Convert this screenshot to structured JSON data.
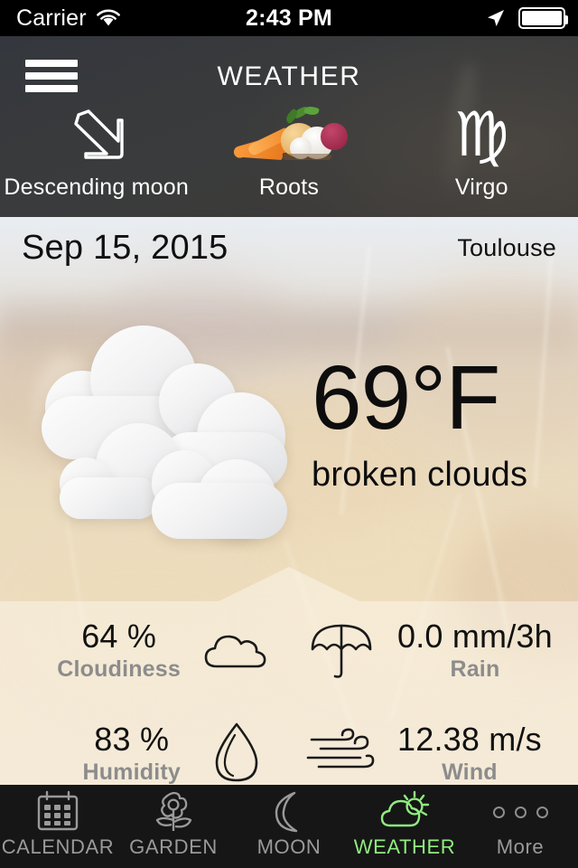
{
  "status_bar": {
    "carrier": "Carrier",
    "time": "2:43 PM",
    "wifi_icon": "wifi-icon",
    "location_icon": "location-arrow-icon",
    "battery_icon": "battery-full-icon"
  },
  "header": {
    "menu_icon": "hamburger-menu-icon",
    "title": "WEATHER",
    "info_items": [
      {
        "icon": "arrow-down-right-icon",
        "label": "Descending moon"
      },
      {
        "icon": "root-vegetables-icon",
        "label": "Roots"
      },
      {
        "icon": "virgo-zodiac-icon",
        "glyph": "♍",
        "label": "Virgo"
      }
    ]
  },
  "weather": {
    "date": "Sep 15, 2015",
    "city": "Toulouse",
    "condition_icon": "broken-clouds-icon",
    "temperature": "69°F",
    "description": "broken clouds",
    "metrics": [
      {
        "value": "64 %",
        "label": "Cloudiness",
        "icon": "cloud-outline-icon"
      },
      {
        "value": "0.0 mm/3h",
        "label": "Rain",
        "icon": "umbrella-icon"
      },
      {
        "value": "83 %",
        "label": "Humidity",
        "icon": "water-drop-icon"
      },
      {
        "value": "12.38 m/s",
        "label": "Wind",
        "icon": "wind-icon"
      }
    ]
  },
  "tab_bar": {
    "active_color": "#90ec80",
    "inactive_color": "#9a9a9a",
    "tabs": [
      {
        "label": "CALENDAR",
        "icon": "calendar-icon",
        "active": false
      },
      {
        "label": "GARDEN",
        "icon": "flower-icon",
        "active": false
      },
      {
        "label": "MOON",
        "icon": "moon-icon",
        "active": false
      },
      {
        "label": "WEATHER",
        "icon": "sun-cloud-icon",
        "active": true
      },
      {
        "label": "More",
        "icon": "more-dots-icon",
        "active": false
      }
    ]
  }
}
